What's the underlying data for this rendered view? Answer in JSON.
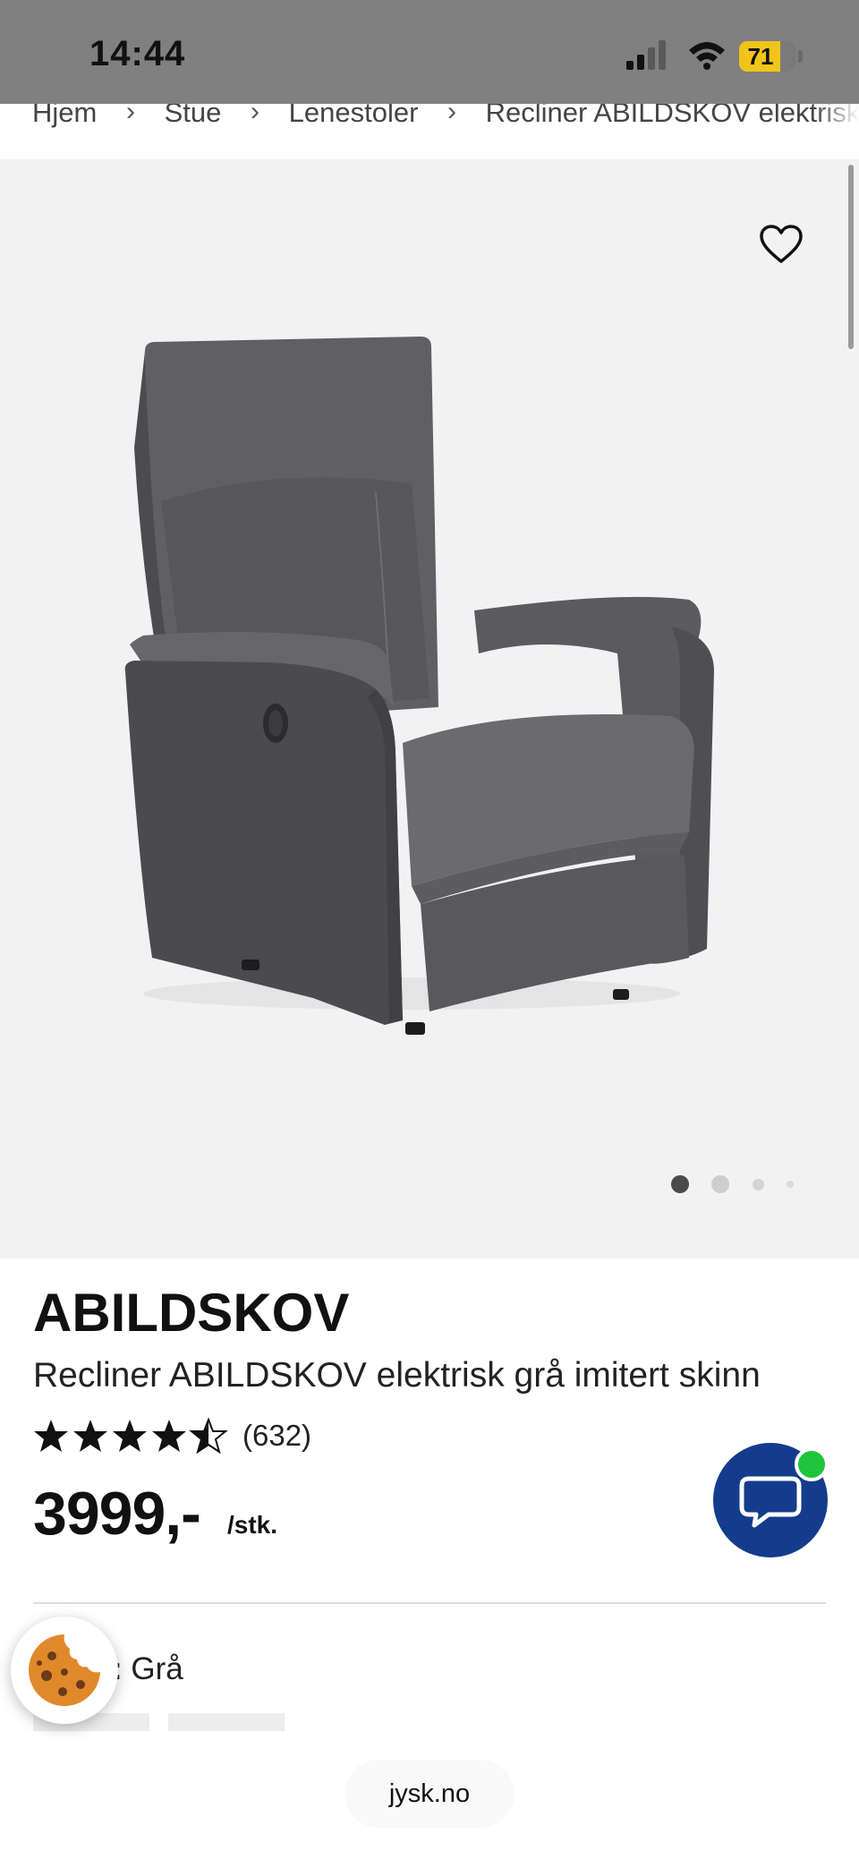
{
  "status": {
    "time": "14:44",
    "battery": "71"
  },
  "breadcrumb": [
    "Hjem",
    "Stue",
    "Lenestoler",
    "Recliner ABILDSKOV elektrisk grå"
  ],
  "breadcrumb_separator": "›",
  "gallery": {
    "slide_count": 4,
    "active_slide": 1
  },
  "product": {
    "brand": "ABILDSKOV",
    "name": "Recliner ABILDSKOV elektrisk grå imitert skinn",
    "rating": 4.5,
    "review_count": "(632)",
    "price": "3999,-",
    "unit": "/stk.",
    "color_label": ":",
    "color_value": "Grå"
  },
  "browser": {
    "url": "jysk.no"
  },
  "colors": {
    "chat_button": "#143c8c",
    "online_indicator": "#1fc43a",
    "battery": "#f0c419"
  }
}
